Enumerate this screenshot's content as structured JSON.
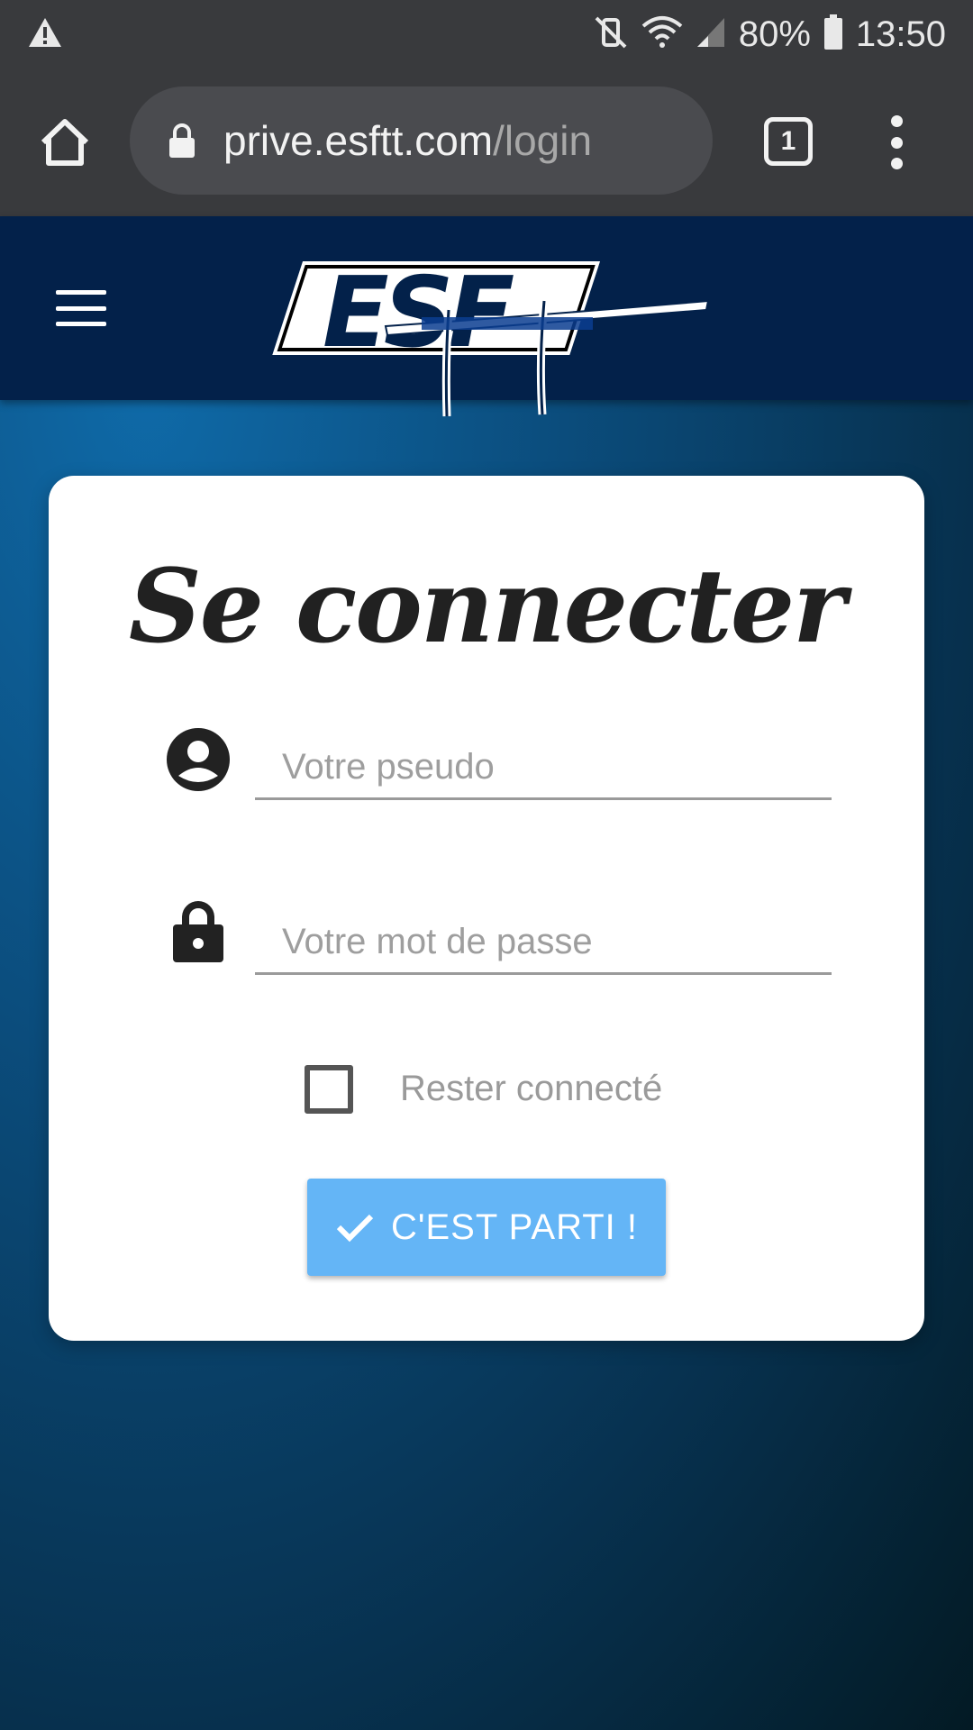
{
  "status_bar": {
    "battery": "80%",
    "time": "13:50",
    "icons": [
      "warning-icon",
      "vibrate-mute-icon",
      "wifi-icon",
      "signal-icon",
      "battery-icon"
    ]
  },
  "browser": {
    "url_host": "prive.esftt.com",
    "url_path": "/login",
    "tab_count": "1"
  },
  "header": {
    "logo_text": "ESFTT"
  },
  "login": {
    "title": "Se connecter",
    "username_placeholder": "Votre pseudo",
    "password_placeholder": "Votre mot de passe",
    "remember_label": "Rester connecté",
    "submit_label": "C'EST PARTI !"
  },
  "colors": {
    "header_bg": "#03214a",
    "button_bg": "#64b5f6",
    "browser_bg": "#393a3d"
  }
}
